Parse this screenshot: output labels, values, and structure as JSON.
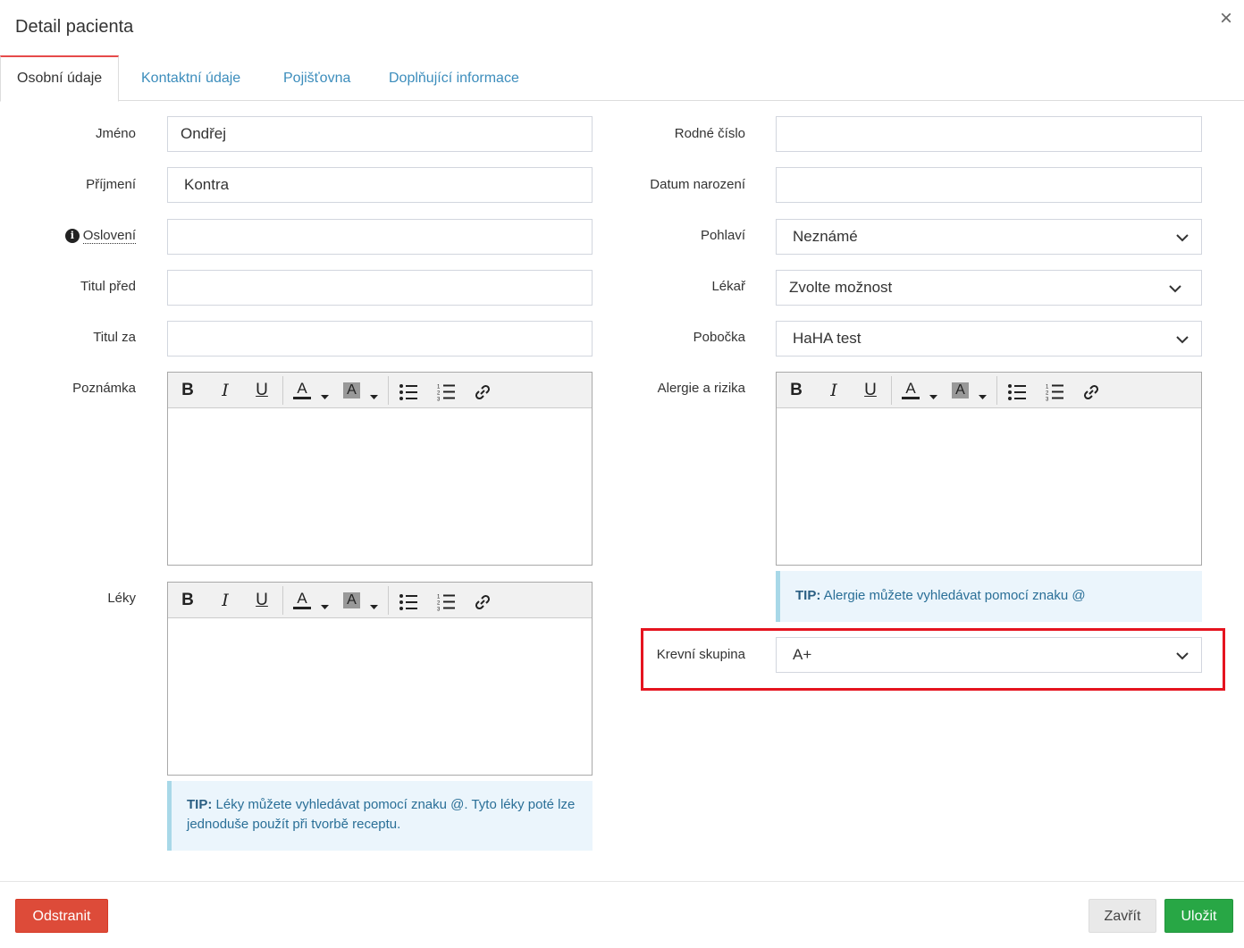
{
  "modal": {
    "title": "Detail pacienta",
    "close_glyph": "×"
  },
  "tabs": [
    {
      "label": "Osobní údaje",
      "active": true
    },
    {
      "label": "Kontaktní údaje",
      "active": false
    },
    {
      "label": "Pojišťovna",
      "active": false
    },
    {
      "label": "Doplňující informace",
      "active": false
    }
  ],
  "left": {
    "jmeno": {
      "label": "Jméno",
      "value": "Ondřej"
    },
    "prijmeni": {
      "label": "Příjmení",
      "value": "Kontra"
    },
    "osloveni": {
      "label": "Oslovení",
      "value": "",
      "info_icon": "info-circle-icon"
    },
    "titul_pred": {
      "label": "Titul před",
      "value": ""
    },
    "titul_za": {
      "label": "Titul za",
      "value": ""
    },
    "poznamka": {
      "label": "Poznámka"
    },
    "leky": {
      "label": "Léky"
    },
    "tip": {
      "strong": "TIP:",
      "text": " Léky můžete vyhledávat pomocí znaku @. Tyto léky poté lze jednoduše použít při tvorbě receptu."
    }
  },
  "right": {
    "rodne_cislo": {
      "label": "Rodné číslo",
      "value": ""
    },
    "datum_narozeni": {
      "label": "Datum narození",
      "value": ""
    },
    "pohlavi": {
      "label": "Pohlaví",
      "value": "Neznámé"
    },
    "lekar": {
      "label": "Lékař",
      "value": "Zvolte možnost"
    },
    "pobocka": {
      "label": "Pobočka",
      "value": "HaHA test"
    },
    "alergie": {
      "label": "Alergie a rizika"
    },
    "tip": {
      "strong": "TIP:",
      "text": " Alergie můžete vyhledávat pomocí znaku @"
    },
    "krevni_skupina": {
      "label": "Krevní skupina",
      "value": "A+"
    }
  },
  "toolbar": {
    "bold": "B",
    "italic": "I",
    "underline": "U",
    "font_color": "A",
    "highlight": "A",
    "icons": [
      "bold-icon",
      "italic-icon",
      "underline-icon",
      "font-color-icon",
      "highlight-color-icon",
      "bullet-list-icon",
      "numbered-list-icon",
      "link-icon"
    ]
  },
  "footer": {
    "delete": "Odstranit",
    "close": "Zavřít",
    "save": "Uložit"
  },
  "colors": {
    "accent_tab": "#e64a4a",
    "link": "#3c8dbc",
    "danger": "#dd4b39",
    "success": "#28a745",
    "highlight_box": "#e5141f"
  }
}
